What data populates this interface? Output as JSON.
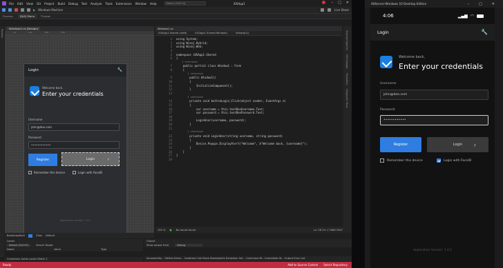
{
  "vs": {
    "menu": [
      "File",
      "Edit",
      "View",
      "Git",
      "Project",
      "Build",
      "Debug",
      "Test",
      "Analyze",
      "Tools",
      "Extensions",
      "Window",
      "Help"
    ],
    "search_placeholder": "Search (Ctrl+Q)",
    "project_name": "iOSApp1",
    "toolbar": {
      "run_label": "Windows Machine",
      "live_share": "Live Share"
    },
    "process": {
      "label": "Process:",
      "value": "[N/A] Mono",
      "thread_label": "Thread:"
    },
    "left_strip": "Toolbox",
    "designer": {
      "tab": "Windows1.cs [Design]",
      "ruler": [
        "10",
        "100",
        "200",
        "300"
      ],
      "form": {
        "header": "Login",
        "welcome": "Welcome back,",
        "heading": "Enter your credentials",
        "username_label": "Username",
        "username_value": "john@doe.com",
        "password_label": "Password",
        "password_value": "••••••••••••",
        "register": "Register",
        "login": "Login",
        "remember": "Remember this device",
        "faceid": "Login with FaceID",
        "version": "Application Version: 1.0.1"
      },
      "bottom": {
        "theme": "BootstrapDark",
        "zoom": "25px",
        "default": "Default"
      }
    },
    "editor": {
      "tab": "Window1.cs",
      "nav_project": "iOSApp1.Shared (net6)",
      "nav_class": "iOSApp1.Shared.Window1",
      "nav_member": "Window1()",
      "lines": [
        {
          "n": "1",
          "t": "using System;"
        },
        {
          "n": "2",
          "t": "using Wisej.Hybrid;"
        },
        {
          "n": "3",
          "t": "using Wisej.Web;"
        },
        {
          "n": "4",
          "t": ""
        },
        {
          "n": "5",
          "t": "namespace iOSApp1.Shared"
        },
        {
          "n": "6",
          "t": "{"
        },
        {
          "n": "",
          "t": "    1 reference"
        },
        {
          "n": "7",
          "t": "    public partial class Window1 : Form"
        },
        {
          "n": "8",
          "t": "    {"
        },
        {
          "n": "",
          "t": "        1 reference"
        },
        {
          "n": "9",
          "t": "        public Window1()"
        },
        {
          "n": "10",
          "t": "        {"
        },
        {
          "n": "11",
          "t": "            InitializeComponent();"
        },
        {
          "n": "12",
          "t": "        }"
        },
        {
          "n": "13",
          "t": ""
        },
        {
          "n": "",
          "t": "        1 reference"
        },
        {
          "n": "14",
          "t": "        private void buttonLogin_Click(object sender, EventArgs e)"
        },
        {
          "n": "15",
          "t": "        {"
        },
        {
          "n": "16",
          "t": "            var username = this.textBoxUsername.Text;"
        },
        {
          "n": "17",
          "t": "            var password = this.textBoxPassword.Text;"
        },
        {
          "n": "18",
          "t": ""
        },
        {
          "n": "19",
          "t": "            LoginUser(username, password);"
        },
        {
          "n": "20",
          "t": "        }"
        },
        {
          "n": "21",
          "t": ""
        },
        {
          "n": "",
          "t": "        1 reference"
        },
        {
          "n": "22",
          "t": "        private void LoginUser(string username, string password)"
        },
        {
          "n": "23",
          "t": "        {"
        },
        {
          "n": "24",
          "t": "            Device.Popups.DisplayAlert(\"Welcome\", $\"Welcome back, {username}\");"
        },
        {
          "n": "25",
          "t": "        }"
        },
        {
          "n": "26",
          "t": "    }"
        },
        {
          "n": "27",
          "t": "}"
        },
        {
          "n": "28",
          "t": ""
        }
      ],
      "status": {
        "zoom": "100 %",
        "issues": "No issues found",
        "position": "Ln: 28   Ch: 1   TABS   CRLF"
      }
    },
    "right_strip": [
      "Solution Explorer",
      "Git Changes",
      "Properties",
      "Diagnostic Tools"
    ],
    "locals": {
      "title": "Locals",
      "search_placeholder": "Search (Ctrl+E)",
      "search_depth": "Search Depth:",
      "columns": [
        "Name",
        "Value",
        "Type"
      ],
      "tabs": "Containers   Autos   Locals   Watch 1"
    },
    "output": {
      "title": "Output",
      "show_label": "Show output from:",
      "show_value": "Debug",
      "tabs": "Accessibility...   GitHub Exten...   CodeLens   Call Stack   Breakpoints   Exception Set...   Command W...   Immediate W...   Output   Error List"
    },
    "status": {
      "ready": "Ready",
      "source_control": "Add to Source Control",
      "repository": "Select Repository"
    }
  },
  "emulator": {
    "title": "AltServer-Windows 10 Desktop Edition",
    "time": "4:06",
    "header": "Login",
    "welcome": "Welcome back,",
    "heading": "Enter your credentials",
    "username_label": "Username",
    "username_value": "john@doe.com",
    "password_label": "Password",
    "password_value": "••••••••••••",
    "register": "Register",
    "login": "Login",
    "remember": "Remember this device",
    "faceid": "Login with FaceID",
    "version": "Application Version: 1.0.1"
  },
  "colors": {
    "accent": "#2f7de0",
    "status_bar": "#c02c40",
    "vs_logo": "#8d52d6"
  }
}
